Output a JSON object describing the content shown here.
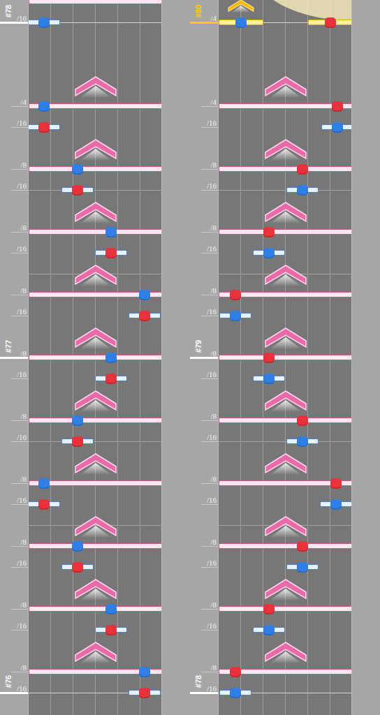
{
  "columns": [
    {
      "arc": false,
      "measures": [
        {
          "label": "#78",
          "slot": 1,
          "selected": false
        },
        {
          "label": "#77",
          "slot": 17,
          "selected": false
        },
        {
          "label": "#76",
          "slot": 33,
          "selected": false
        }
      ],
      "rows": [
        {
          "slot": 0,
          "kind": "bar",
          "pos": 3,
          "width": 6,
          "flick": false,
          "selected": false
        },
        {
          "slot": 1,
          "beat": "/16",
          "kind": "short",
          "pos": 0.7,
          "width": 1.44,
          "color": "#2f7fe6",
          "flick": false,
          "selected": false
        },
        {
          "slot": 5,
          "beat": "/4",
          "kind": "bar",
          "pos": 0.7,
          "width": 6,
          "color": "#2f7fe6",
          "flick": true,
          "selected": false
        },
        {
          "slot": 6,
          "beat": "/16",
          "kind": "short",
          "pos": 0.7,
          "width": 1.44,
          "color": "#e8323c",
          "flick": false,
          "selected": false
        },
        {
          "slot": 8,
          "beat": "/8",
          "kind": "bar",
          "pos": 2.2,
          "width": 6,
          "color": "#2f7fe6",
          "flick": true,
          "selected": false
        },
        {
          "slot": 9,
          "beat": "/16",
          "kind": "short",
          "pos": 2.2,
          "width": 1.44,
          "color": "#e8323c",
          "flick": false,
          "selected": false
        },
        {
          "slot": 11,
          "beat": "/8",
          "kind": "bar",
          "pos": 3.7,
          "width": 6,
          "color": "#2f7fe6",
          "flick": true,
          "selected": false
        },
        {
          "slot": 12,
          "beat": "/16",
          "kind": "short",
          "pos": 3.7,
          "width": 1.44,
          "color": "#e8323c",
          "flick": false,
          "selected": false
        },
        {
          "slot": 14,
          "beat": "/8",
          "kind": "bar",
          "pos": 5.2,
          "width": 6,
          "color": "#2f7fe6",
          "flick": true,
          "selected": false
        },
        {
          "slot": 15,
          "beat": "/16",
          "kind": "short",
          "pos": 5.2,
          "width": 1.44,
          "color": "#e8323c",
          "flick": false,
          "selected": false
        },
        {
          "slot": 17,
          "beat": "/8",
          "kind": "bar",
          "pos": 3.7,
          "width": 6,
          "color": "#2f7fe6",
          "flick": true,
          "selected": false
        },
        {
          "slot": 18,
          "beat": "/16",
          "kind": "short",
          "pos": 3.7,
          "width": 1.44,
          "color": "#e8323c",
          "flick": false,
          "selected": false
        },
        {
          "slot": 20,
          "beat": "/8",
          "kind": "bar",
          "pos": 2.2,
          "width": 6,
          "color": "#2f7fe6",
          "flick": true,
          "selected": false
        },
        {
          "slot": 21,
          "beat": "/16",
          "kind": "short",
          "pos": 2.2,
          "width": 1.44,
          "color": "#e8323c",
          "flick": false,
          "selected": false
        },
        {
          "slot": 23,
          "beat": "/8",
          "kind": "bar",
          "pos": 0.7,
          "width": 6,
          "color": "#2f7fe6",
          "flick": true,
          "selected": false
        },
        {
          "slot": 24,
          "beat": "/16",
          "kind": "short",
          "pos": 0.7,
          "width": 1.44,
          "color": "#e8323c",
          "flick": false,
          "selected": false
        },
        {
          "slot": 26,
          "beat": "/8",
          "kind": "bar",
          "pos": 2.2,
          "width": 6,
          "color": "#2f7fe6",
          "flick": true,
          "selected": false
        },
        {
          "slot": 27,
          "beat": "/16",
          "kind": "short",
          "pos": 2.2,
          "width": 1.44,
          "color": "#e8323c",
          "flick": false,
          "selected": false
        },
        {
          "slot": 29,
          "beat": "/8",
          "kind": "bar",
          "pos": 3.7,
          "width": 6,
          "color": "#2f7fe6",
          "flick": true,
          "selected": false
        },
        {
          "slot": 30,
          "beat": "/16",
          "kind": "short",
          "pos": 3.7,
          "width": 1.44,
          "color": "#e8323c",
          "flick": false,
          "selected": false
        },
        {
          "slot": 32,
          "beat": "/8",
          "kind": "bar",
          "pos": 5.2,
          "width": 6,
          "color": "#2f7fe6",
          "flick": true,
          "selected": false
        },
        {
          "slot": 33,
          "beat": "/16",
          "kind": "short",
          "pos": 5.2,
          "width": 1.44,
          "color": "#e8323c",
          "flick": false,
          "selected": false
        }
      ]
    },
    {
      "arc": true,
      "measures": [
        {
          "label": "#80",
          "slot": 1,
          "selected": true
        },
        {
          "label": "#79",
          "slot": 17,
          "selected": false
        },
        {
          "label": "#78",
          "slot": 33,
          "selected": false
        }
      ],
      "rows": [
        {
          "slot": 1,
          "beat": "/4",
          "kind": "short",
          "pos": 1,
          "width": 2,
          "color": "#2f7fe6",
          "flick": true,
          "selected": true
        },
        {
          "slot": 1,
          "kind": "short",
          "pos": 5,
          "width": 2,
          "color": "#e8323c",
          "flick": false,
          "selected": true
        },
        {
          "slot": 5,
          "beat": "/4",
          "kind": "bar",
          "pos": 5.3,
          "width": 6,
          "color": "#e8323c",
          "flick": true,
          "selected": false
        },
        {
          "slot": 6,
          "beat": "/16",
          "kind": "short",
          "pos": 5.3,
          "width": 1.44,
          "color": "#2f7fe6",
          "flick": false,
          "selected": false
        },
        {
          "slot": 8,
          "beat": "/8",
          "kind": "bar",
          "pos": 3.75,
          "width": 6,
          "color": "#e8323c",
          "flick": true,
          "selected": false
        },
        {
          "slot": 9,
          "beat": "/16",
          "kind": "short",
          "pos": 3.75,
          "width": 1.44,
          "color": "#2f7fe6",
          "flick": false,
          "selected": false
        },
        {
          "slot": 11,
          "beat": "/8",
          "kind": "bar",
          "pos": 2.25,
          "width": 6,
          "color": "#e8323c",
          "flick": true,
          "selected": false
        },
        {
          "slot": 12,
          "beat": "/16",
          "kind": "short",
          "pos": 2.25,
          "width": 1.44,
          "color": "#2f7fe6",
          "flick": false,
          "selected": false
        },
        {
          "slot": 14,
          "beat": "/8",
          "kind": "bar",
          "pos": 0.75,
          "width": 6,
          "color": "#e8323c",
          "flick": true,
          "selected": false
        },
        {
          "slot": 15,
          "beat": "/16",
          "kind": "short",
          "pos": 0.75,
          "width": 1.44,
          "color": "#2f7fe6",
          "flick": false,
          "selected": false
        },
        {
          "slot": 17,
          "beat": "/8",
          "kind": "bar",
          "pos": 2.25,
          "width": 6,
          "color": "#e8323c",
          "flick": true,
          "selected": false
        },
        {
          "slot": 18,
          "beat": "/16",
          "kind": "short",
          "pos": 2.25,
          "width": 1.44,
          "color": "#2f7fe6",
          "flick": false,
          "selected": false
        },
        {
          "slot": 20,
          "beat": "/8",
          "kind": "bar",
          "pos": 3.75,
          "width": 6,
          "color": "#e8323c",
          "flick": true,
          "selected": false
        },
        {
          "slot": 21,
          "beat": "/16",
          "kind": "short",
          "pos": 3.75,
          "width": 1.44,
          "color": "#2f7fe6",
          "flick": false,
          "selected": false
        },
        {
          "slot": 23,
          "beat": "/8",
          "kind": "bar",
          "pos": 5.25,
          "width": 6,
          "color": "#e8323c",
          "flick": true,
          "selected": false
        },
        {
          "slot": 24,
          "beat": "/16",
          "kind": "short",
          "pos": 5.25,
          "width": 1.44,
          "color": "#2f7fe6",
          "flick": false,
          "selected": false
        },
        {
          "slot": 26,
          "beat": "/8",
          "kind": "bar",
          "pos": 3.75,
          "width": 6,
          "color": "#e8323c",
          "flick": true,
          "selected": false
        },
        {
          "slot": 27,
          "beat": "/16",
          "kind": "short",
          "pos": 3.75,
          "width": 1.44,
          "color": "#2f7fe6",
          "flick": false,
          "selected": false
        },
        {
          "slot": 29,
          "beat": "/8",
          "kind": "bar",
          "pos": 2.25,
          "width": 6,
          "color": "#e8323c",
          "flick": true,
          "selected": false
        },
        {
          "slot": 30,
          "beat": "/16",
          "kind": "short",
          "pos": 2.25,
          "width": 1.44,
          "color": "#2f7fe6",
          "flick": false,
          "selected": false
        },
        {
          "slot": 32,
          "beat": "/8",
          "kind": "bar",
          "pos": 0.75,
          "width": 6,
          "color": "#e8323c",
          "flick": true,
          "selected": false
        },
        {
          "slot": 33,
          "beat": "/16",
          "kind": "short",
          "pos": 0.75,
          "width": 1.44,
          "color": "#2f7fe6",
          "flick": false,
          "selected": false
        }
      ]
    }
  ]
}
